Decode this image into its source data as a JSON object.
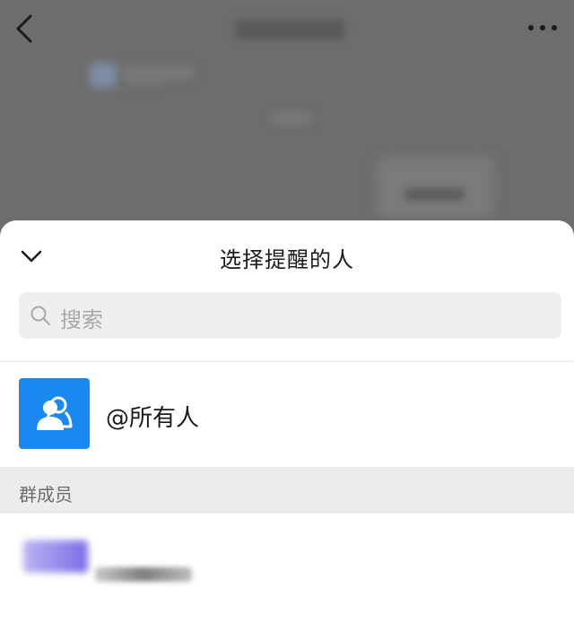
{
  "chat": {
    "back_icon": "chevron-left-icon",
    "more_icon": "more-horizontal-icon"
  },
  "sheet": {
    "title": "选择提醒的人",
    "collapse_icon": "chevron-down-icon",
    "search": {
      "placeholder": "搜索",
      "icon": "search-icon"
    },
    "everyone": {
      "label": "@所有人",
      "icon": "group-icon",
      "avatar_color": "#1b87f1"
    },
    "section_label": "群成员"
  },
  "colors": {
    "overlay": "#6d6d6d",
    "accent": "#1b87f1",
    "search_bg": "#efefef",
    "section_bg": "#ececec"
  }
}
